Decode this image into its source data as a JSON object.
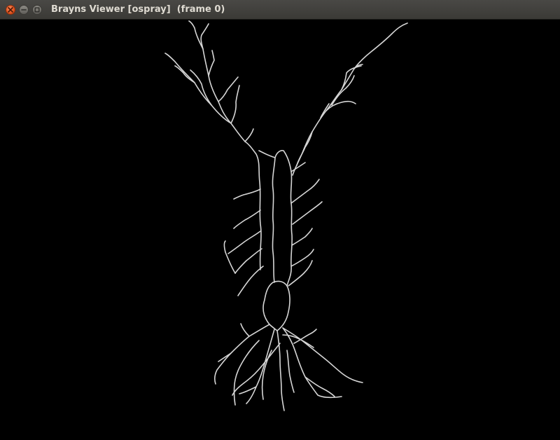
{
  "window": {
    "title": "Brayns Viewer [ospray]  (frame 0)"
  },
  "controls": {
    "close_icon": "close-x-icon",
    "minimize_icon": "minimize-icon",
    "maximize_icon": "maximize-icon"
  },
  "viewport": {
    "background": "#000000",
    "render_color": "#d6d6d6",
    "content": "neuron-morphology-render"
  }
}
